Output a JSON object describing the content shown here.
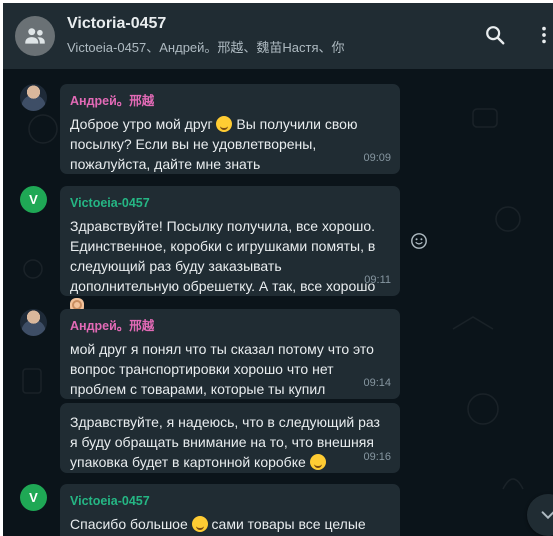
{
  "header": {
    "title": "Victoria-0457",
    "subtitle": "Victoeia-0457、Андрей。邢越、魏苗Настя、你",
    "icons": {
      "group": "group-icon",
      "search": "search-icon",
      "menu": "more-vertical-icon"
    }
  },
  "messages": [
    {
      "sender": "Андрей。邢越",
      "text_a": "Доброе утро мой друг",
      "text_b": "Вы получили свою посылку? Если вы не удовлетворены, пожалуйста, дайте мне знать",
      "time": "09:09",
      "emoji": "smiling-face-emoji"
    },
    {
      "sender": "Victoeia-0457",
      "avatar_letter": "V",
      "text_a": "Здравствуйте! Посылку получила, все хорошо. Единственное, коробки с игрушками помяты, в следующий раз буду заказывать дополнительную обрешетку. А так, все хорошо",
      "time": "09:11",
      "emoji": "ok-hand-emoji"
    },
    {
      "sender": "Андрей。邢越",
      "text_a": "мой друг я понял что ты сказал потому что это вопрос транспортировки хорошо что нет проблем с товарами, которые ты купил",
      "time": "09:14"
    },
    {
      "text_a": "Здравствуйте, я надеюсь, что в следующий раз я буду обращать внимание на то, что внешняя упаковка будет в картонной коробке",
      "time": "09:16",
      "emoji": "grinning-face-emoji"
    },
    {
      "sender": "Victoeia-0457",
      "avatar_letter": "V",
      "text_a": "Спасибо большое",
      "text_b": "сами товары все целые",
      "emoji": "smiling-face-emoji"
    }
  ],
  "colors": {
    "header_bg": "#202c33",
    "chat_bg": "#0b141a",
    "bubble_bg": "#202c33",
    "sender_pink": "#e26ab6",
    "sender_green": "#25b684",
    "time": "#8696a0"
  }
}
